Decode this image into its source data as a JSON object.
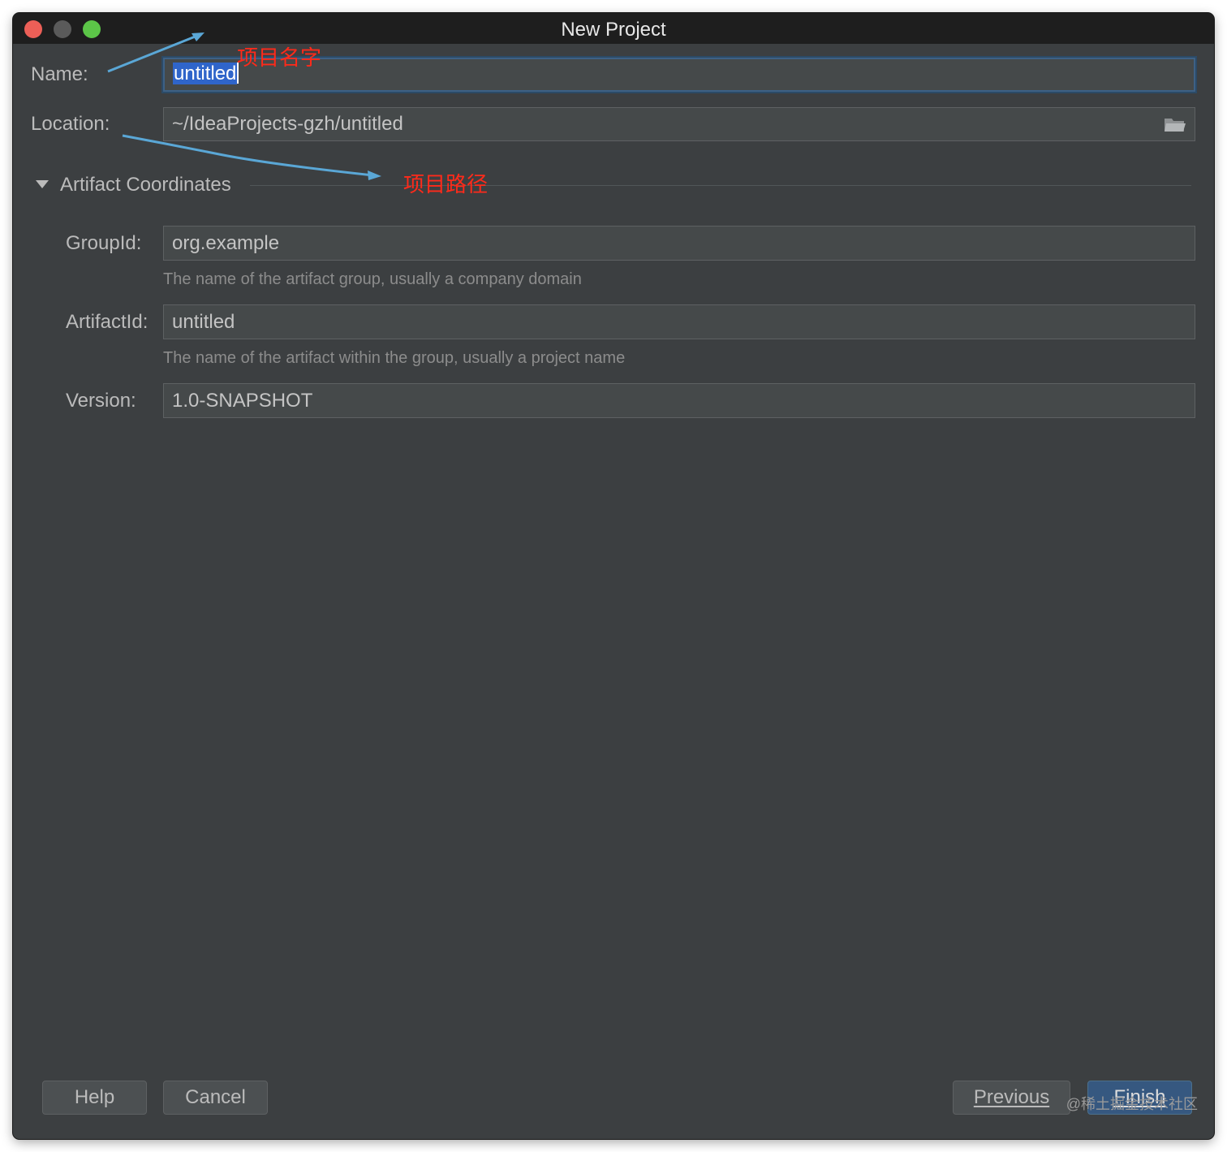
{
  "window": {
    "title": "New Project"
  },
  "form": {
    "name_label": "Name:",
    "name_value": "untitled",
    "location_label": "Location:",
    "location_value": "~/IdeaProjects-gzh/untitled",
    "section_title": "Artifact Coordinates",
    "groupid_label": "GroupId:",
    "groupid_value": "org.example",
    "groupid_hint": "The name of the artifact group, usually a company domain",
    "artifactid_label": "ArtifactId:",
    "artifactid_value": "untitled",
    "artifactid_hint": "The name of the artifact within the group, usually a project name",
    "version_label": "Version:",
    "version_value": "1.0-SNAPSHOT"
  },
  "buttons": {
    "help": "Help",
    "cancel": "Cancel",
    "previous": "Previous",
    "finish": "Finish"
  },
  "annotations": {
    "name_note": "项目名字",
    "path_note": "项目路径",
    "arrow_color": "#5aa7d6"
  },
  "watermark": "@稀土掘金技术社区",
  "icons": [
    "folder-icon",
    "expand-triangle-icon"
  ],
  "colors": {
    "background": "#3c3f41",
    "titlebar": "#1e1e1e",
    "field": "#45494a",
    "selection": "#2f65ca",
    "primary_button": "#365880",
    "annotation_red": "#ff2a1a"
  }
}
